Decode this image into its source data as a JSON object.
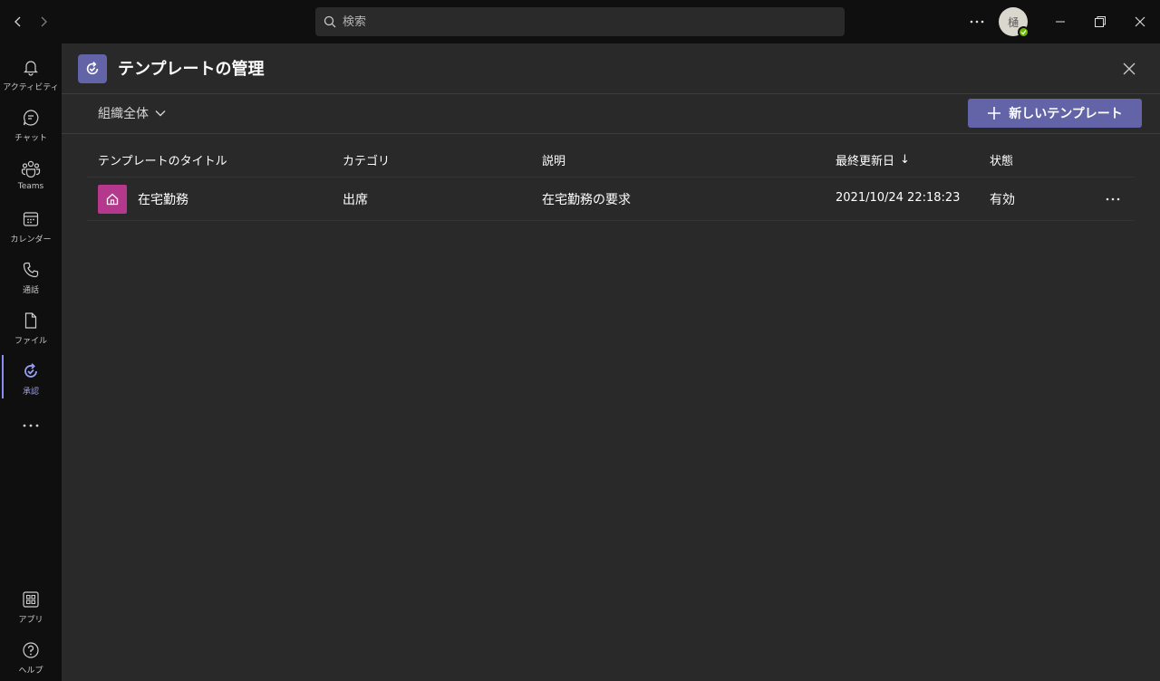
{
  "search": {
    "placeholder": "検索"
  },
  "user": {
    "avatar_initial": "樋"
  },
  "rail": {
    "items": [
      {
        "label": "アクティビティ"
      },
      {
        "label": "チャット"
      },
      {
        "label": "Teams"
      },
      {
        "label": "カレンダー"
      },
      {
        "label": "通話"
      },
      {
        "label": "ファイル"
      },
      {
        "label": "承認"
      }
    ],
    "apps_label": "アプリ",
    "help_label": "ヘルプ",
    "active_index": 6
  },
  "header": {
    "title": "テンプレートの管理"
  },
  "toolbar": {
    "scope_label": "組織全体",
    "new_button_label": "新しいテンプレート"
  },
  "table": {
    "columns": [
      "テンプレートのタイトル",
      "カテゴリ",
      "説明",
      "最終更新日",
      "状態"
    ],
    "sort_indicator": "↓",
    "rows": [
      {
        "title": "在宅勤務",
        "category": "出席",
        "description": "在宅勤務の要求",
        "updated": "2021/10/24 22:18:23",
        "status": "有効"
      }
    ]
  },
  "colors": {
    "accent": "#6264a7",
    "row_icon": "#b4388c",
    "presence": "#6bb700",
    "active_rail": "#9aa0f0"
  }
}
